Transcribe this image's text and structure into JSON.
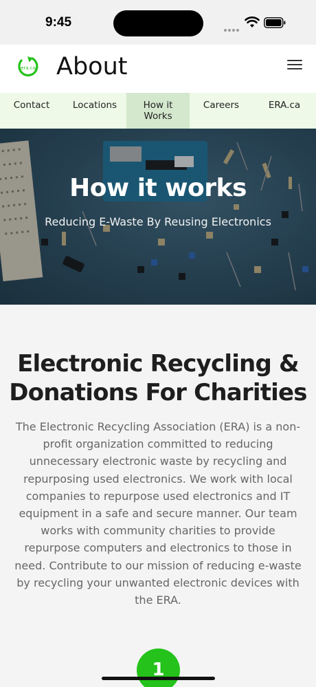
{
  "status": {
    "time": "9:45"
  },
  "header": {
    "title": "About",
    "logo_text": "era.ca"
  },
  "nav": {
    "tabs": [
      {
        "label": "Contact"
      },
      {
        "label": "Locations"
      },
      {
        "label": "How it Works"
      },
      {
        "label": "Careers"
      },
      {
        "label": "ERA.ca"
      }
    ],
    "active_tab": "How it Works"
  },
  "hero": {
    "title": "How it works",
    "subtitle": "Reducing E-Waste By Reusing Electronics"
  },
  "section": {
    "heading": "Electronic Recycling & Donations For Charities",
    "body": "The Electronic Recycling Association (ERA) is a non-profit organization committed to reducing unnecessary electronic waste by recycling and repurposing used electronics. We work with local companies to repurpose used electronics and IT equipment in a safe and secure manner. Our team works with community charities to provide repurpose computers and electronics to those in need. Contribute to our mission of reducing e-waste by recycling your unwanted electronic devices with the ERA."
  },
  "steps": {
    "first_number": "1"
  },
  "colors": {
    "brand_green": "#24c21a",
    "tab_bar_bg": "#eef9e8",
    "tab_active_bg": "#d4e8cd"
  },
  "icons": [
    "wifi-icon",
    "battery-icon",
    "menu-icon",
    "era-logo"
  ]
}
